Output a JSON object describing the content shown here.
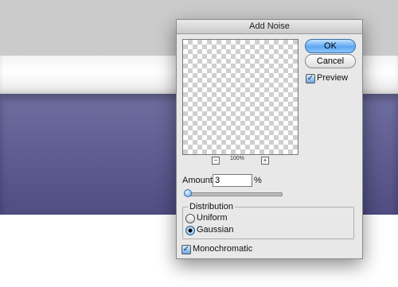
{
  "dialog": {
    "title": "Add Noise",
    "ok_label": "OK",
    "cancel_label": "Cancel",
    "preview_label": "Preview",
    "preview_checked": true,
    "zoom": {
      "minus": "−",
      "plus": "+",
      "level": "100%"
    },
    "amount": {
      "label": "Amount:",
      "value": "3",
      "unit": "%",
      "slider_fraction": 0.03
    },
    "distribution": {
      "title": "Distribution",
      "options": [
        {
          "label": "Uniform",
          "selected": false
        },
        {
          "label": "Gaussian",
          "selected": true
        }
      ]
    },
    "monochromatic": {
      "label": "Monochromatic",
      "checked": true
    }
  },
  "icons": {
    "check": "✓"
  },
  "colors": {
    "accent": "#5da8f2",
    "canvas_purple": "#5f5d92",
    "canvas_gray": "#cbcbcb"
  }
}
